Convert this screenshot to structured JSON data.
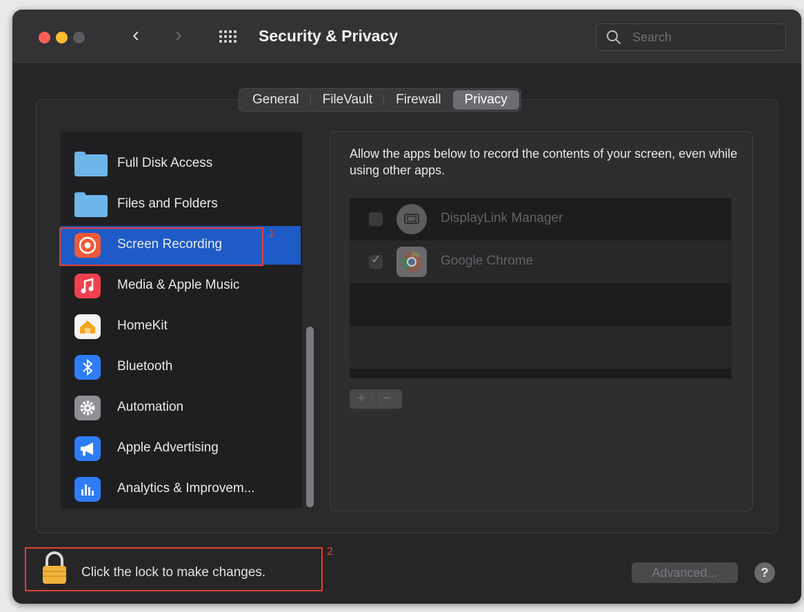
{
  "window": {
    "title": "Security & Privacy",
    "search_placeholder": "Search"
  },
  "tabs": [
    {
      "label": "General"
    },
    {
      "label": "FileVault"
    },
    {
      "label": "Firewall"
    },
    {
      "label": "Privacy",
      "active": true
    }
  ],
  "sidebar": {
    "items": [
      {
        "label": "Full Disk Access",
        "icon": "folder-icon"
      },
      {
        "label": "Files and Folders",
        "icon": "folder-icon"
      },
      {
        "label": "Screen Recording",
        "icon": "screen-recording-icon",
        "selected": true
      },
      {
        "label": "Media & Apple Music",
        "icon": "music-icon"
      },
      {
        "label": "HomeKit",
        "icon": "home-icon"
      },
      {
        "label": "Bluetooth",
        "icon": "bluetooth-icon"
      },
      {
        "label": "Automation",
        "icon": "gear-icon"
      },
      {
        "label": "Apple Advertising",
        "icon": "megaphone-icon"
      },
      {
        "label": "Analytics & Improvem...",
        "icon": "analytics-icon"
      }
    ]
  },
  "content": {
    "description": "Allow the apps below to record the contents of your screen, even while using other apps.",
    "apps": [
      {
        "name": "DisplayLink Manager",
        "checked": false,
        "icon": "displaylink-icon"
      },
      {
        "name": "Google Chrome",
        "checked": true,
        "icon": "chrome-icon"
      }
    ],
    "add_label": "+",
    "remove_label": "−"
  },
  "footer": {
    "lock_text": "Click the lock to make changes.",
    "advanced_label": "Advanced...",
    "help_label": "?"
  },
  "annotations": {
    "marker_1": "1",
    "marker_2": "2",
    "marker_color": "#e5412f"
  },
  "colors": {
    "selection": "#1f5bc6",
    "window_bg": "#262628"
  }
}
